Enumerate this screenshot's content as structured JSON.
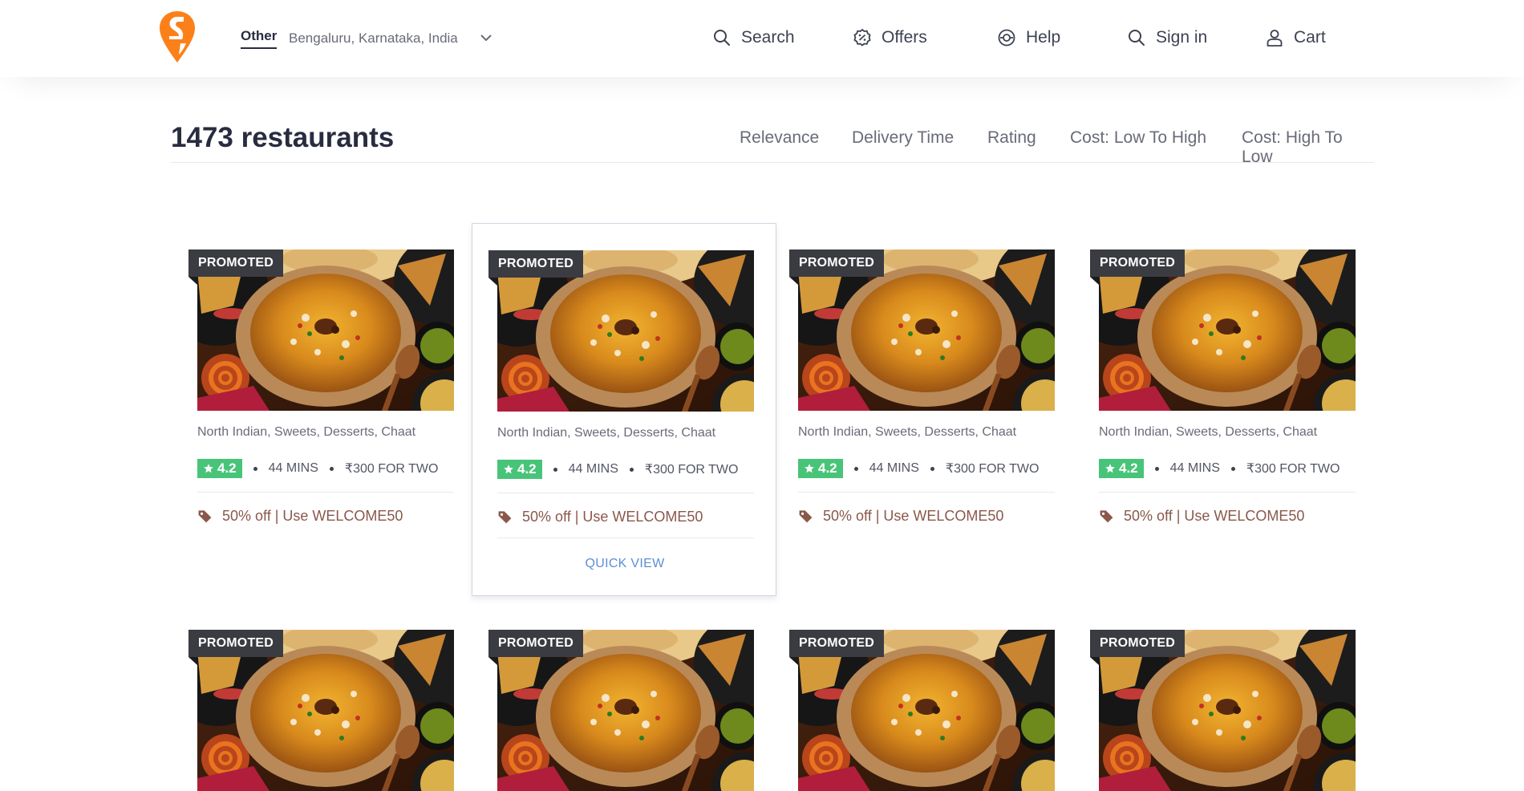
{
  "header": {
    "location_type": "Other",
    "location_text": "Bengaluru, Karnataka, India",
    "nav": [
      {
        "label": "Search",
        "icon": "search-icon"
      },
      {
        "label": "Offers",
        "icon": "offers-icon"
      },
      {
        "label": "Help",
        "icon": "help-icon"
      },
      {
        "label": "Sign in",
        "icon": "search-icon"
      },
      {
        "label": "Cart",
        "icon": "user-icon"
      }
    ]
  },
  "listing": {
    "count_title": "1473 restaurants",
    "sort_options": [
      "Relevance",
      "Delivery Time",
      "Rating",
      "Cost: Low To High",
      "Cost: High To Low"
    ]
  },
  "cards": [
    {
      "badge": "PROMOTED",
      "cuisines": "North Indian, Sweets, Desserts, Chaat",
      "rating": "4.2",
      "time": "44 MINS",
      "cost": "₹300 FOR TWO",
      "offer": "50% off | Use WELCOME50"
    },
    {
      "badge": "PROMOTED",
      "cuisines": "North Indian, Sweets, Desserts, Chaat",
      "rating": "4.2",
      "time": "44 MINS",
      "cost": "₹300 FOR TWO",
      "offer": "50% off | Use WELCOME50",
      "quick_view": "QUICK VIEW"
    },
    {
      "badge": "PROMOTED",
      "cuisines": "North Indian, Sweets, Desserts, Chaat",
      "rating": "4.2",
      "time": "44 MINS",
      "cost": "₹300 FOR TWO",
      "offer": "50% off | Use WELCOME50"
    },
    {
      "badge": "PROMOTED",
      "cuisines": "North Indian, Sweets, Desserts, Chaat",
      "rating": "4.2",
      "time": "44 MINS",
      "cost": "₹300 FOR TWO",
      "offer": "50% off | Use WELCOME50"
    },
    {
      "badge": "PROMOTED"
    },
    {
      "badge": "PROMOTED"
    },
    {
      "badge": "PROMOTED"
    },
    {
      "badge": "PROMOTED"
    }
  ],
  "colors": {
    "brand": "#fc8019",
    "rating_bg": "#48c479",
    "offer": "#8a584b",
    "link": "#5d8ed5"
  }
}
